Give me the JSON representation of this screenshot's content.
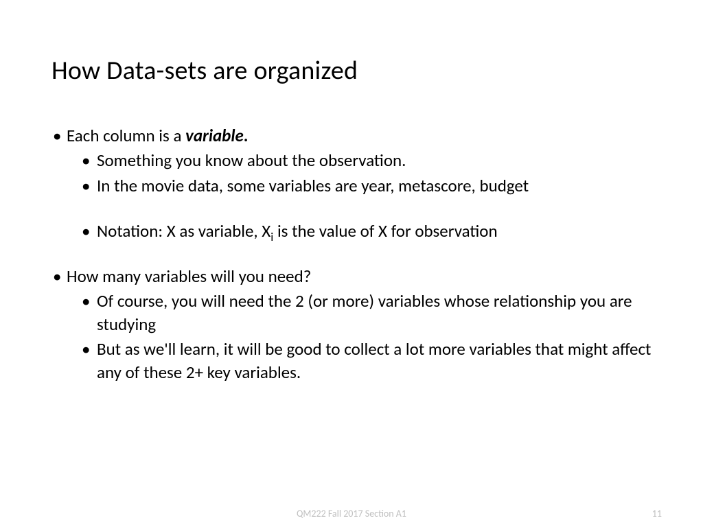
{
  "title": "How Data-sets are organized",
  "bullets": {
    "item1_prefix": "Each column is a ",
    "item1_bold": "variable",
    "item1_suffix": ".",
    "item1_sub1": "Something you know about the observation.",
    "item1_sub2": "In the movie data, some variables are year, metascore, budget",
    "item1_sub3_part1": "Notation: X as variable, X",
    "item1_sub3_sub": "i",
    "item1_sub3_part2": " is the value of X for observation",
    "item2": "How many variables will you need?",
    "item2_sub1": "Of course, you will need the 2 (or more) variables whose relationship you are studying",
    "item2_sub2": "But as we'll learn, it will be good to collect a lot more variables that  might affect any of these 2+ key variables."
  },
  "footer": {
    "center": "QM222 Fall 2017 Section A1",
    "page": "11"
  }
}
